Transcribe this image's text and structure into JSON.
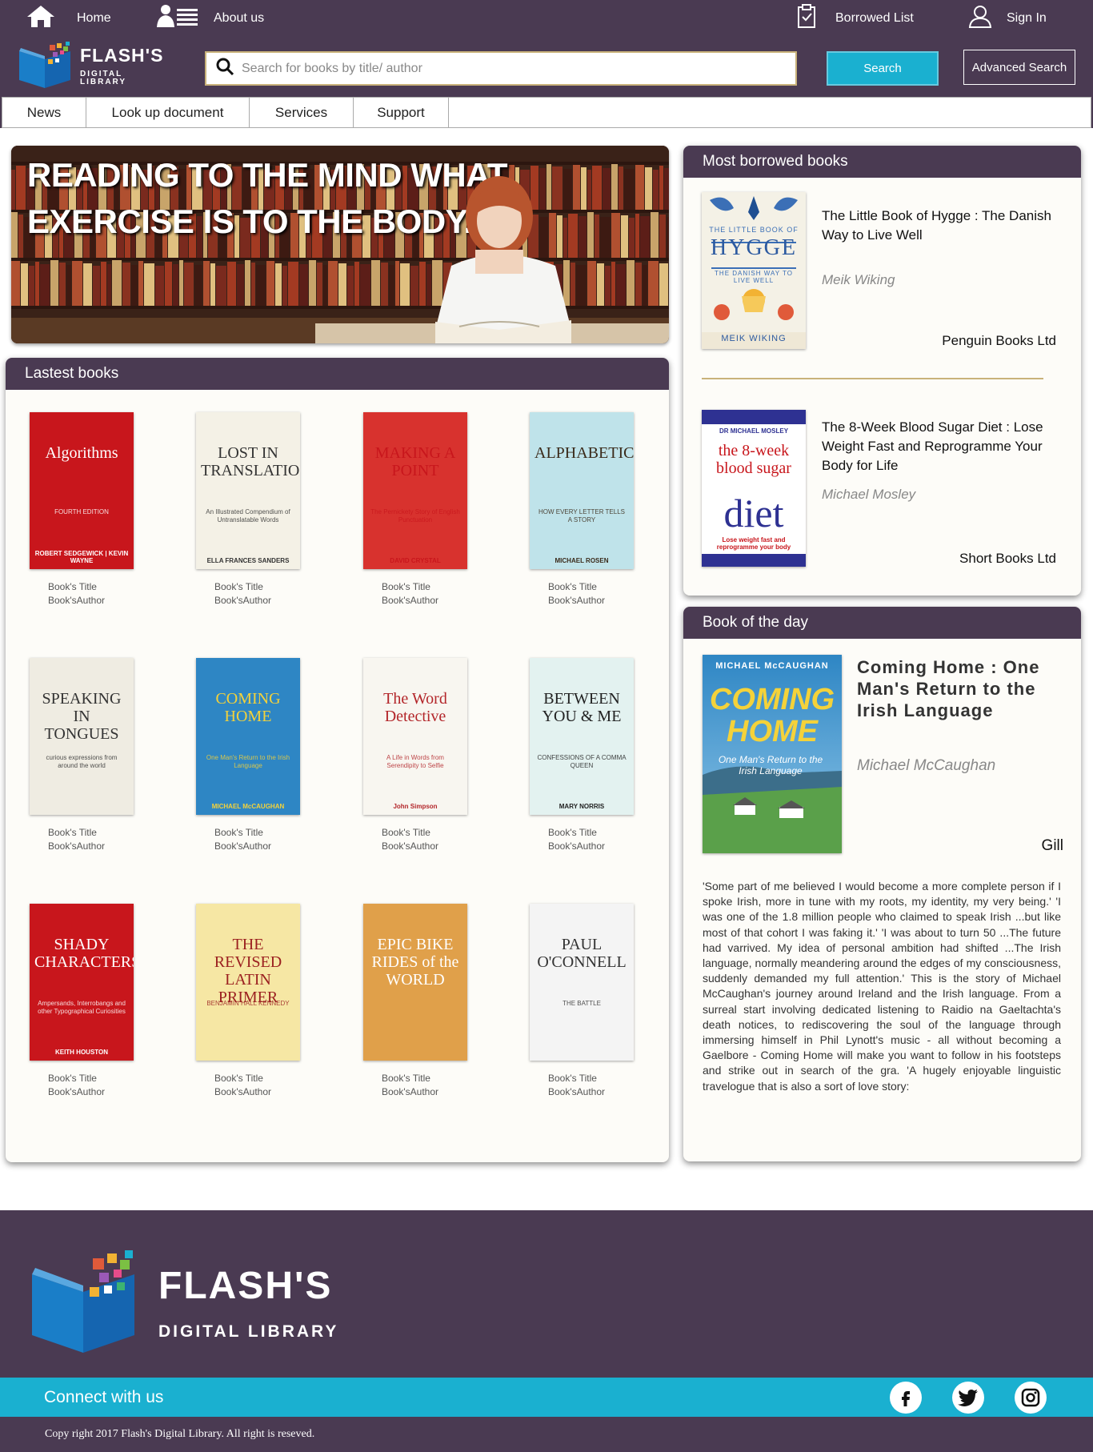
{
  "topbar": {
    "home_label": "Home",
    "about_label": "About us",
    "borrowed_label": "Borrowed List",
    "signin_label": "Sign In"
  },
  "header": {
    "logo_line1": "FLASH'S",
    "logo_line2": "DIGITAL LIBRARY",
    "search_placeholder": "Search for books by title/ author",
    "search_value": "",
    "search_button": "Search",
    "advanced_button": "Advanced Search"
  },
  "nav": {
    "items": [
      {
        "label": "News"
      },
      {
        "label": "Look up document"
      },
      {
        "label": "Services"
      },
      {
        "label": "Support"
      }
    ]
  },
  "banner": {
    "quote_line1": "READING TO THE MIND WHAT",
    "quote_line2": "EXERCISE IS TO THE BODY."
  },
  "latest": {
    "heading": "Lastest books",
    "books": [
      {
        "cover_text": "Algorithms",
        "cover_sub": "FOURTH EDITION",
        "cover_author": "ROBERT SEDGEWICK | KEVIN WAYNE",
        "title": "Book's Title",
        "author": "Book'sAuthor",
        "bg": "#c8161c",
        "fg": "#ffffff"
      },
      {
        "cover_text": "LOST IN TRANSLATION",
        "cover_sub": "An Illustrated Compendium of Untranslatable Words",
        "cover_author": "ELLA FRANCES SANDERS",
        "title": "Book's Title",
        "author": "Book'sAuthor",
        "bg": "#f4f1e6",
        "fg": "#333333"
      },
      {
        "cover_text": "MAKING A POINT",
        "cover_sub": "The Pernickety Story of English Punctuation",
        "cover_author": "DAVID CRYSTAL",
        "title": "Book's Title",
        "author": "Book'sAuthor",
        "bg": "#d8322e",
        "fg": "#c8161c"
      },
      {
        "cover_text": "ALPHABETICAL",
        "cover_sub": "HOW EVERY LETTER TELLS A STORY",
        "cover_author": "MICHAEL ROSEN",
        "title": "Book's Title",
        "author": "Book'sAuthor",
        "bg": "#bfe3ea",
        "fg": "#3a2a1a"
      },
      {
        "cover_text": "SPEAKING IN TONGUES",
        "cover_sub": "curious expressions from around the world",
        "cover_author": "",
        "title": "Book's Title",
        "author": "Book'sAuthor",
        "bg": "#efece2",
        "fg": "#333333"
      },
      {
        "cover_text": "COMING HOME",
        "cover_sub": "One Man's Return to the Irish Language",
        "cover_author": "MICHAEL McCAUGHAN",
        "title": "Book's Title",
        "author": "Book'sAuthor",
        "bg": "#2e86c4",
        "fg": "#f4d23a"
      },
      {
        "cover_text": "The Word Detective",
        "cover_sub": "A Life in Words from Serendipity to Selfie",
        "cover_author": "John Simpson",
        "title": "Book's Title",
        "author": "Book'sAuthor",
        "bg": "#f8f6f0",
        "fg": "#b3262a"
      },
      {
        "cover_text": "BETWEEN YOU & ME",
        "cover_sub": "CONFESSIONS OF A COMMA QUEEN",
        "cover_author": "MARY NORRIS",
        "title": "Book's Title",
        "author": "Book'sAuthor",
        "bg": "#e3f2f0",
        "fg": "#222222"
      },
      {
        "cover_text": "SHADY CHARACTERS",
        "cover_sub": "Ampersands, Interrobangs and other Typographical Curiosities",
        "cover_author": "KEITH HOUSTON",
        "title": "Book's Title",
        "author": "Book'sAuthor",
        "bg": "#c8161c",
        "fg": "#ffffff"
      },
      {
        "cover_text": "THE REVISED LATIN PRIMER",
        "cover_sub": "BENJAMIN HALL KENNEDY",
        "cover_author": "",
        "title": "Book's Title",
        "author": "Book'sAuthor",
        "bg": "#f6e7a4",
        "fg": "#9b2020"
      },
      {
        "cover_text": "EPIC BIKE RIDES of the WORLD",
        "cover_sub": "",
        "cover_author": "",
        "title": "Book's Title",
        "author": "Book'sAuthor",
        "bg": "#e0a04a",
        "fg": "#ffffff"
      },
      {
        "cover_text": "PAUL O'CONNELL",
        "cover_sub": "THE BATTLE",
        "cover_author": "",
        "title": "Book's Title",
        "author": "Book'sAuthor",
        "bg": "#f4f4f4",
        "fg": "#333333"
      }
    ]
  },
  "borrowed": {
    "heading": "Most borrowed books",
    "items": [
      {
        "title": "The Little Book of Hygge : The Danish Way to Live Well",
        "author": "Meik Wiking",
        "publisher": "Penguin Books Ltd",
        "cover_text": "HYGGE",
        "cover_sub": "THE LITTLE BOOK OF",
        "cover_tag": "THE DANISH WAY TO LIVE WELL",
        "cover_author": "MEIK WIKING"
      },
      {
        "title": "The 8-Week Blood Sugar Diet : Lose Weight Fast and Reprogramme Your Body for Life",
        "author": "Michael Mosley",
        "publisher": "Short Books Ltd",
        "cover_text": "diet",
        "cover_sub": "the 8-week blood sugar",
        "cover_tag": "Lose weight fast and reprogramme your body",
        "cover_author": "DR MICHAEL MOSLEY"
      }
    ]
  },
  "botd": {
    "heading": "Book of the day",
    "title": "Coming Home : One Man's Return to the Irish Language",
    "author": "Michael McCaughan",
    "publisher": "Gill",
    "cover_author": "MICHAEL McCAUGHAN",
    "cover_text": "COMING HOME",
    "cover_sub": "One Man's Return to the Irish Language",
    "description": "'Some part of me believed I would become a more complete person if I spoke Irish, more in tune with my roots, my identity, my very being.' 'I was one of the 1.8 million people who claimed to speak Irish ...but like most of that cohort I was faking it.' 'I was about to turn 50 ...The future had varrived. My idea of personal ambition had shifted ...The Irish language, normally meandering around the edges of my consciousness, suddenly demanded my full attention.' This is the story of Michael McCaughan's journey around Ireland and the Irish language. From a surreal start involving dedicated listening to Raidio na Gaeltachta's death notices, to rediscovering the soul of the language through immersing himself in Phil Lynott's music - all without becoming a Gaelbore - Coming Home will make you want to follow in his footsteps and strike out in search of the gra. 'A hugely enjoyable linguistic travelogue that is also a sort of love story:"
  },
  "footer": {
    "logo_line1": "FLASH'S",
    "logo_line2": "DIGITAL LIBRARY",
    "connect_label": "Connect with us",
    "social": [
      "facebook-icon",
      "twitter-icon",
      "instagram-icon"
    ],
    "copyright": "Copy right 2017 Flash's Digital Library. All right is reseved."
  },
  "colors": {
    "brand_purple": "#4a3a52",
    "accent_cyan": "#1ab0d0",
    "accent_gold": "#c9b27a"
  }
}
